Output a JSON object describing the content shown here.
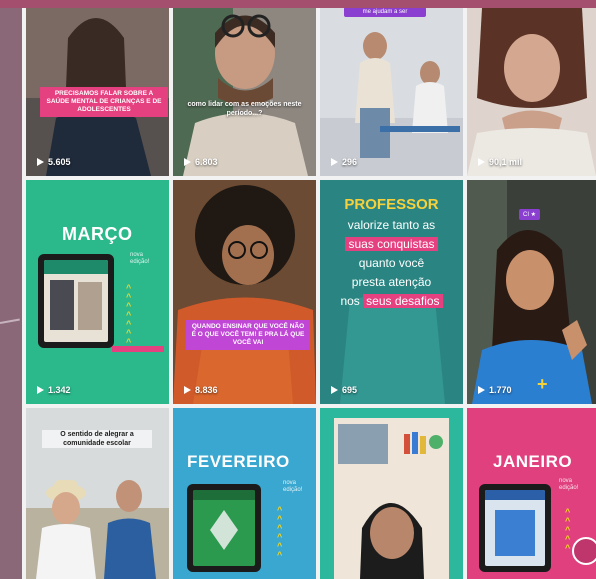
{
  "tiles": [
    {
      "views": "5.605",
      "caption": "PRECISAMOS FALAR SOBRE A SAÚDE MENTAL DE CRIANÇAS E DE ADOLESCENTES"
    },
    {
      "views": "6.803",
      "caption": "como lidar com as emoções neste período...?"
    },
    {
      "views": "296",
      "tag": "me ajudam a ser"
    },
    {
      "views": "90,1 mil"
    },
    {
      "views": "1.342",
      "month": "MARÇO",
      "edition": "nova edição!"
    },
    {
      "views": "8.836",
      "caption": "QUANDO ENSINAR QUE VOCÊ NÃO É O QUE VOCÊ TEM! E PRA LÁ QUE VOCÊ VAI"
    },
    {
      "views": "695",
      "title": "PROFESSOR",
      "lines": [
        "valorize tanto as",
        "suas conquistas",
        "quanto você",
        "presta atenção",
        "nos",
        "seus desafios"
      ]
    },
    {
      "views": "1.770",
      "tag": "CI ★"
    },
    {
      "caption": "O sentido de alegrar a comunidade escolar"
    },
    {
      "month": "FEVEREIRO",
      "edition": "nova edição!"
    },
    {},
    {
      "month": "JANEIRO",
      "edition": "nova edição!"
    }
  ]
}
